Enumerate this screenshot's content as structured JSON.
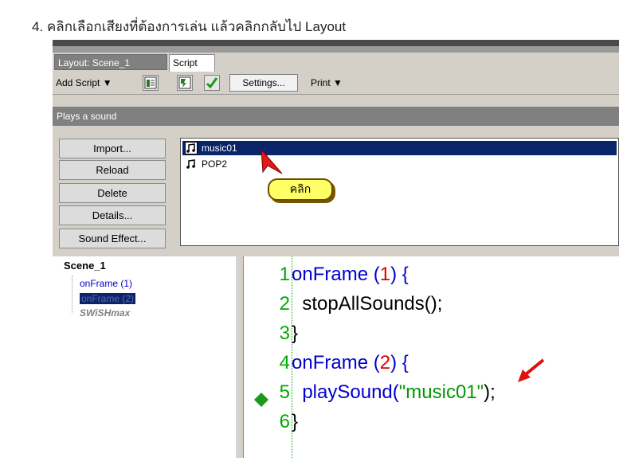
{
  "instruction": "4. คลิกเลือกเสียงที่ต้องการเล่น แล้วคลิกกลับไป Layout",
  "tabs": [
    {
      "label": "Layout: Scene_1"
    },
    {
      "label": "Script"
    }
  ],
  "toolbar": {
    "add_script_label": "Add Script ▼",
    "settings_label": "Settings...",
    "print_label": "Print ▼"
  },
  "description": "Plays a sound",
  "sound_buttons": [
    "Import...",
    "Reload",
    "Delete",
    "Details...",
    "Sound Effect..."
  ],
  "sounds": [
    {
      "name": "music01",
      "selected": true
    },
    {
      "name": "POP2",
      "selected": false
    }
  ],
  "callout": {
    "label": "คลิก"
  },
  "scene_tree": {
    "root": "Scene_1",
    "items": [
      "onFrame (1)",
      "onFrame (2)",
      "SWiSHmax"
    ]
  },
  "code": [
    {
      "ln": "1",
      "parts": [
        {
          "t": "onFrame (",
          "c": "kw"
        },
        {
          "t": "1",
          "c": "num"
        },
        {
          "t": ") {",
          "c": "kw"
        }
      ]
    },
    {
      "ln": "2",
      "parts": [
        {
          "t": "  stopAllSounds();",
          "c": "txt"
        }
      ]
    },
    {
      "ln": "3",
      "parts": [
        {
          "t": "}",
          "c": "txt"
        }
      ]
    },
    {
      "ln": "4",
      "parts": [
        {
          "t": "onFrame (",
          "c": "kw"
        },
        {
          "t": "2",
          "c": "num"
        },
        {
          "t": ") {",
          "c": "kw"
        }
      ]
    },
    {
      "ln": "5",
      "parts": [
        {
          "t": "  playSound(",
          "c": "kw"
        },
        {
          "t": "\"music01\"",
          "c": "str"
        },
        {
          "t": ");",
          "c": "txt"
        }
      ]
    },
    {
      "ln": "6",
      "parts": [
        {
          "t": "}",
          "c": "txt"
        }
      ]
    }
  ],
  "colors": {
    "selection": "#0a246a",
    "keyword": "#0000cc",
    "number": "#dd0000",
    "string": "#009900",
    "line_number": "#00aa00",
    "arrow": "#dd1111",
    "callout_fill": "#ffff66"
  },
  "icons": [
    "note-icon",
    "checkmark-icon",
    "script-tree-icon",
    "script-edit-icon",
    "breakpoint-diamond-icon",
    "pointer-arrow-icon"
  ]
}
